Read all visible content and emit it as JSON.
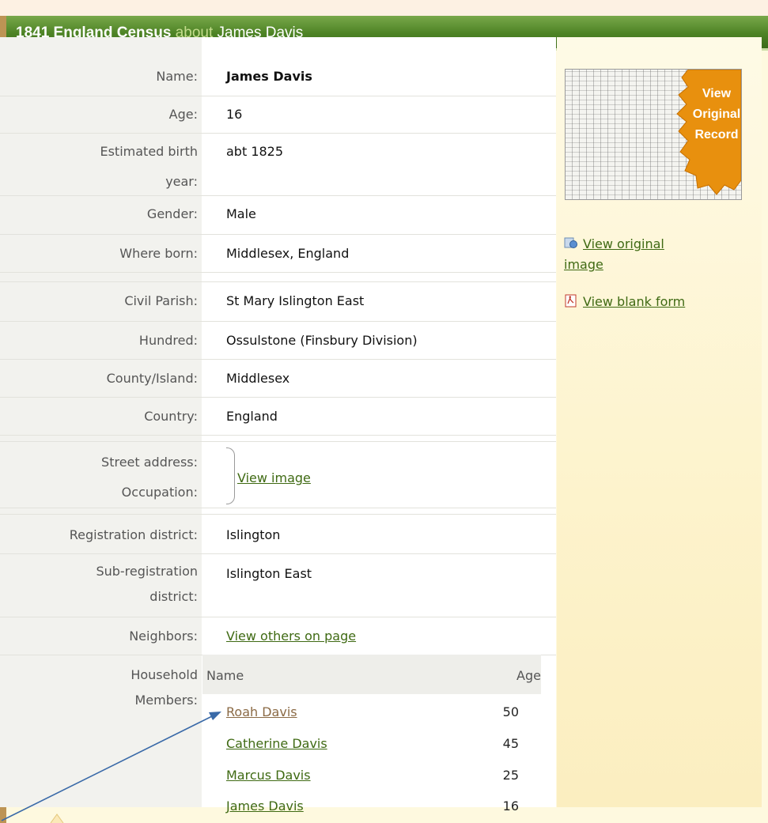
{
  "header": {
    "title": "1841 England Census",
    "about": "about",
    "person": "James Davis"
  },
  "fields": [
    {
      "label": "Name:",
      "value": "James Davis"
    },
    {
      "label": "Age:",
      "value": "16"
    },
    {
      "label_line1": "Estimated birth",
      "label_line2": "year:",
      "value": "abt 1825"
    },
    {
      "label": "Gender:",
      "value": "Male"
    },
    {
      "label": "Where born:",
      "value": "Middlesex, England"
    },
    {
      "label": "Civil Parish:",
      "value": "St Mary Islington East"
    },
    {
      "label": "Hundred:",
      "value": "Ossulstone (Finsbury Division)"
    },
    {
      "label": "County/Island:",
      "value": "Middlesex"
    },
    {
      "label": "Country:",
      "value": "England"
    },
    {
      "label_line1": "Street address:",
      "label_line2": "Occupation:",
      "value_link": "View image"
    },
    {
      "label": "Registration district:",
      "value": "Islington"
    },
    {
      "label_line1": "Sub-registration",
      "label_line2": "district:",
      "value": "Islington East"
    },
    {
      "label": "Neighbors:",
      "value_link": "View others on page"
    }
  ],
  "household": {
    "label_line1": "Household",
    "label_line2": "Members:",
    "col_name": "Name",
    "col_age": "Age",
    "members": [
      {
        "name": "Roah Davis",
        "age": "50"
      },
      {
        "name": "Catherine Davis",
        "age": "45"
      },
      {
        "name": "Marcus Davis",
        "age": "25"
      },
      {
        "name": "James Davis",
        "age": "16"
      }
    ]
  },
  "sidebar": {
    "badge_line1": "View",
    "badge_line2": "Original",
    "badge_line3": "Record",
    "view_original_line1": "View original",
    "view_original_line2": "image",
    "view_blank_form": "View blank form"
  },
  "colors": {
    "title_green": "#4d8325",
    "link_green": "#3f6a13",
    "badge_orange": "#e8900e",
    "arrow_blue": "#3a6aa8"
  }
}
